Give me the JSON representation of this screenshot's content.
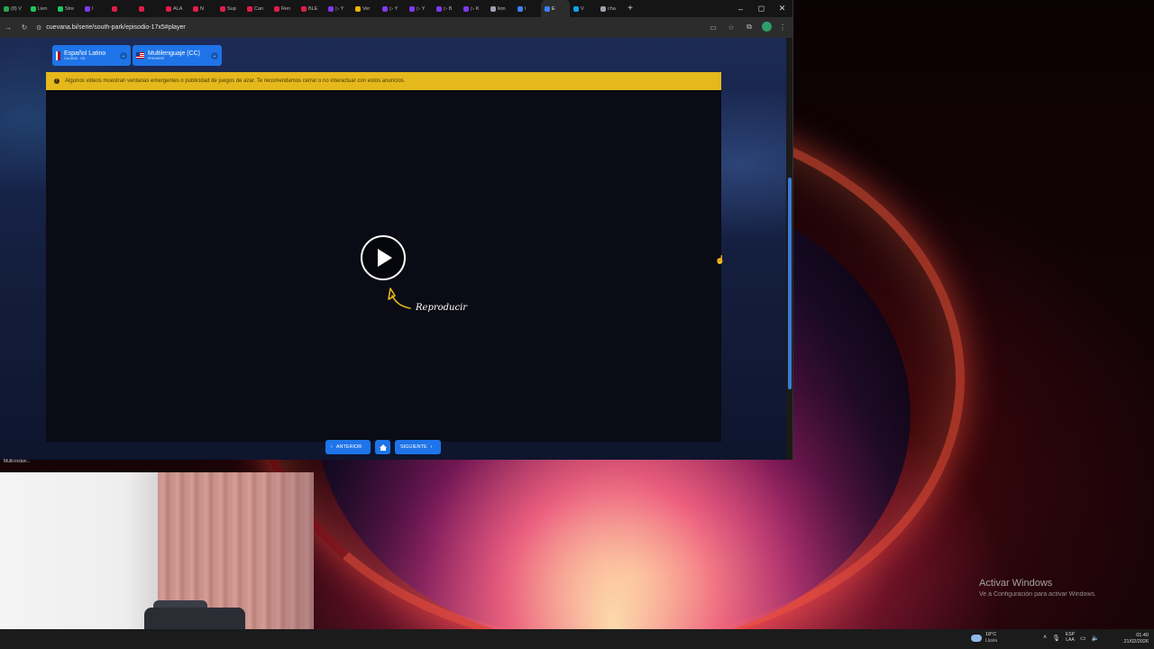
{
  "browser": {
    "tabs": [
      {
        "label": "(8) V",
        "color": "#2ea44f"
      },
      {
        "label": "Lien",
        "color": "#22c55e"
      },
      {
        "label": "Stre",
        "color": "#22c55e"
      },
      {
        "label": "I",
        "color": "#7c3aed"
      },
      {
        "label": "",
        "color": "#e11d48"
      },
      {
        "label": "",
        "color": "#e11d48"
      },
      {
        "label": "ALA",
        "color": "#e11d48"
      },
      {
        "label": "N",
        "color": "#e11d48"
      },
      {
        "label": "Sup",
        "color": "#e11d48"
      },
      {
        "label": "Can",
        "color": "#e11d48"
      },
      {
        "label": "Ren",
        "color": "#e11d48"
      },
      {
        "label": "BLE",
        "color": "#e11d48"
      },
      {
        "label": "▷ Y",
        "color": "#7c3aed"
      },
      {
        "label": "Ver",
        "color": "#eab308"
      },
      {
        "label": "▷ Y",
        "color": "#7c3aed"
      },
      {
        "label": "▷ Y",
        "color": "#7c3aed"
      },
      {
        "label": "▷ B",
        "color": "#7c3aed"
      },
      {
        "label": "▷ K",
        "color": "#7c3aed"
      },
      {
        "label": "lion",
        "color": "#9ca3af"
      },
      {
        "label": "I",
        "color": "#3b82f6"
      },
      {
        "label": "E",
        "color": "#3b82f6",
        "active": true
      },
      {
        "label": "V",
        "color": "#0ea5e9"
      },
      {
        "label": "cha",
        "color": "#9ca3af"
      }
    ],
    "new_tab": "+",
    "url": "cuevana.bi/serie/south-park/episodio-17x5#player"
  },
  "page": {
    "audio_dropdown": {
      "label": "Español Latino",
      "sub": "CALIDAD · HD"
    },
    "subs_dropdown": {
      "label": "Multilenguaje (CC)",
      "sub": "PREMIERE"
    },
    "warning": "Algunos videos muestran ventanas emergentes o publicidad de juegos de azar. Te recomendamos cerrar o no interactuar con estos anuncios.",
    "play_label": "Reproducir",
    "prev_label": "ANTERIOR",
    "next_label": "SIGUIENTE"
  },
  "desktop": {
    "multi_instance_label": "Multi-instan...",
    "watermark_title": "Activar Windows",
    "watermark_sub": "Ve a Configuración para activar Windows."
  },
  "taskbar": {
    "weather_temp": "18°C",
    "weather_desc": "Lluvia",
    "lang_top": "ESP",
    "lang_bottom": "LAA",
    "time": "01:40",
    "date": "21/02/2026"
  }
}
